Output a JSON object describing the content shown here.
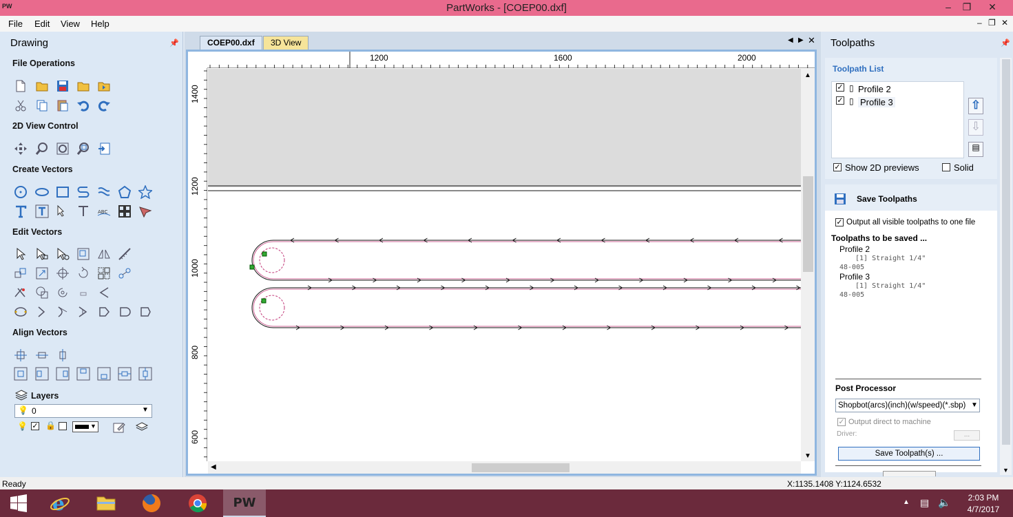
{
  "app": {
    "icon_text": "PW",
    "title": "PartWorks - [COEP00.dxf]"
  },
  "window_controls": {
    "minimize": "–",
    "restore": "❐",
    "close": "✕"
  },
  "menu": [
    {
      "label": "File"
    },
    {
      "label": "Edit"
    },
    {
      "label": "View"
    },
    {
      "label": "Help"
    }
  ],
  "mdi_controls": {
    "minimize": "–",
    "restore": "❐",
    "close": "✕"
  },
  "left_panel": {
    "title": "Drawing",
    "sections": {
      "file_operations": "File Operations",
      "view_control": "2D View Control",
      "create_vectors": "Create Vectors",
      "edit_vectors": "Edit Vectors",
      "align_vectors": "Align Vectors",
      "layers": "Layers"
    },
    "layer_value": "0"
  },
  "tabs": [
    {
      "label": "COEP00.dxf"
    },
    {
      "label": "3D View"
    }
  ],
  "rulers": {
    "top": [
      "1200",
      "1600",
      "2000"
    ],
    "left": [
      "1400",
      "1200",
      "1000",
      "800",
      "600"
    ]
  },
  "right_panel": {
    "title": "Toolpaths",
    "toolpath_list_title": "Toolpath List",
    "toolpaths": [
      {
        "name": "Profile 2",
        "checked": true
      },
      {
        "name": "Profile 3",
        "checked": true
      }
    ],
    "show_2d_previews": "Show 2D previews",
    "solid": "Solid",
    "save_title": "Save Toolpaths",
    "output_all": "Output all visible toolpaths to one file",
    "to_be_saved_title": "Toolpaths to be saved ...",
    "saved": [
      {
        "name": "Profile 2",
        "tool": "[1] Straight 1/4\"",
        "code": "48-005"
      },
      {
        "name": "Profile 3",
        "tool": "[1] Straight 1/4\"",
        "code": "48-005"
      }
    ],
    "post_processor_title": "Post Processor",
    "post_processor_value": "Shopbot(arcs)(inch)(w/speed)(*.sbp)",
    "output_direct": "Output direct to machine",
    "driver_label": "Driver:",
    "driver_button": "...",
    "save_button": "Save Toolpath(s) ..."
  },
  "status": {
    "left": "Ready",
    "coords": "X:1135.1408 Y:1124.6532"
  },
  "taskbar": {
    "time": "2:03 PM",
    "date": "4/7/2017",
    "pw_label": "PW"
  },
  "colors": {
    "titlebar": "#e96a8d",
    "left_panel": "#dce8f5",
    "taskbar": "#6b2a3c",
    "accent": "#2f6fbf",
    "toolpath": "#c23a7a"
  }
}
